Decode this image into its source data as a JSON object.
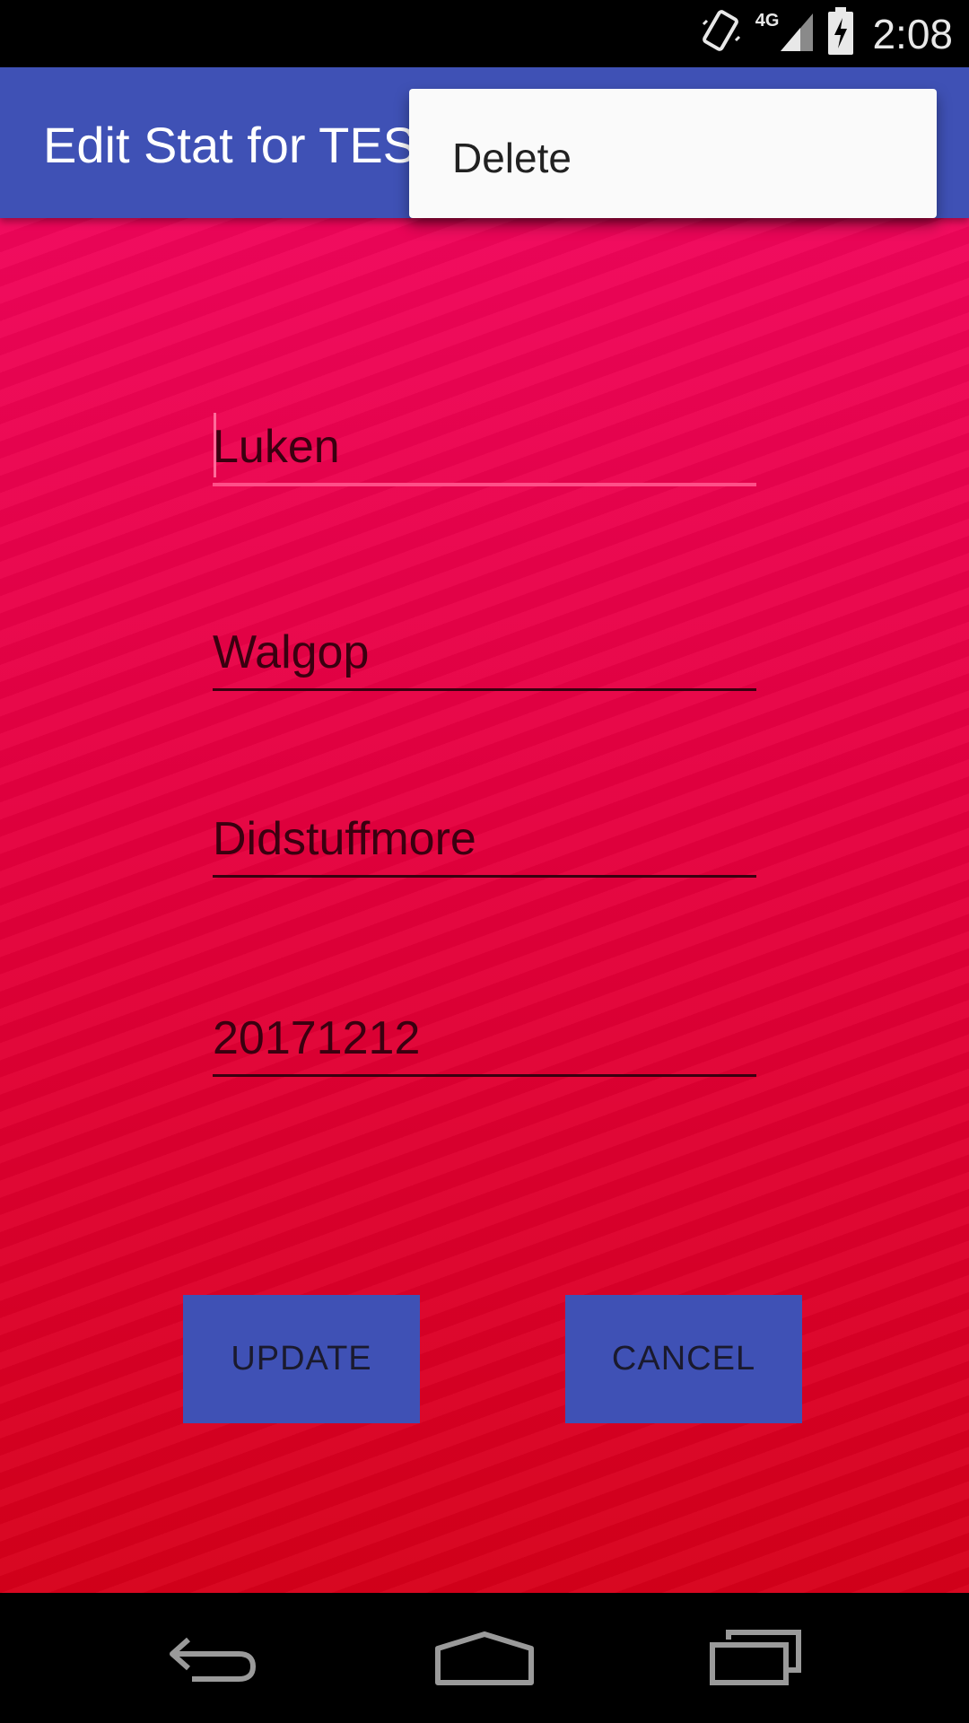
{
  "status_bar": {
    "time": "2:08",
    "network": "4G",
    "icons": [
      "vibrate-icon",
      "signal-icon",
      "battery-charging-icon"
    ]
  },
  "app_bar": {
    "title": "Edit Stat for TEST"
  },
  "overflow_menu": {
    "items": [
      {
        "label": "Delete"
      }
    ]
  },
  "form": {
    "fields": [
      {
        "value": "Luken"
      },
      {
        "value": "Walgop"
      },
      {
        "value": "Didstuffmore"
      },
      {
        "value": "20171212"
      }
    ]
  },
  "buttons": {
    "update_label": "UPDATE",
    "cancel_label": "CANCEL"
  },
  "nav_bar": {
    "icons": [
      "back-icon",
      "home-icon",
      "recents-icon"
    ]
  },
  "colors": {
    "app_bar": "#3f51b5",
    "background_top": "#f0055a",
    "background_bottom": "#d7001a",
    "button": "#3f51b5",
    "focus_underline": "#ff4f88"
  }
}
